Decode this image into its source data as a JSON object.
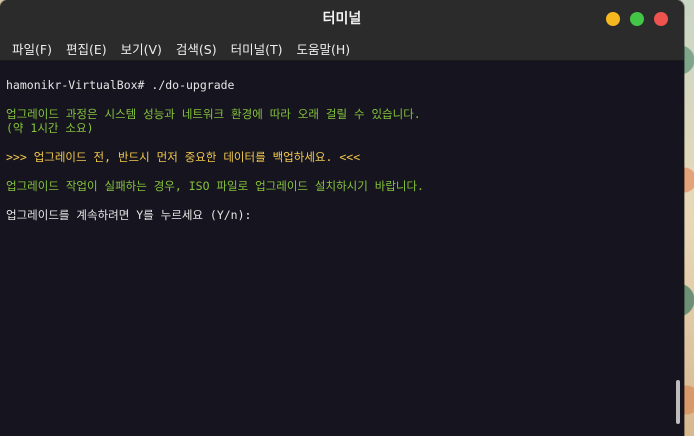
{
  "window": {
    "title": "터미널"
  },
  "menu": [
    "파일(F)",
    "편집(E)",
    "보기(V)",
    "검색(S)",
    "터미널(T)",
    "도움말(H)"
  ],
  "terminal": {
    "prompt_line": "hamonikr-VirtualBox# ./do-upgrade",
    "notice_line1": "업그레이드 과정은 시스템 성능과 네트워크 환경에 따라 오래 걸릴 수 있습니다.",
    "notice_line2": "(약 1시간 소요)",
    "warning_line": ">>> 업그레이드 전, 반드시 먼저 중요한 데이터를 백업하세요. <<<",
    "failure_line": "업그레이드 작업이 실패하는 경우, ISO 파일로 업그레이드 설치하시기 바랍니다.",
    "confirm_line": "업그레이드를 계속하려면 Y를 누르세요 (Y/n):"
  },
  "colors": {
    "background": "#15141f",
    "text": "#e6e6e6",
    "green": "#86c33b",
    "yellow": "#f2c94c"
  }
}
